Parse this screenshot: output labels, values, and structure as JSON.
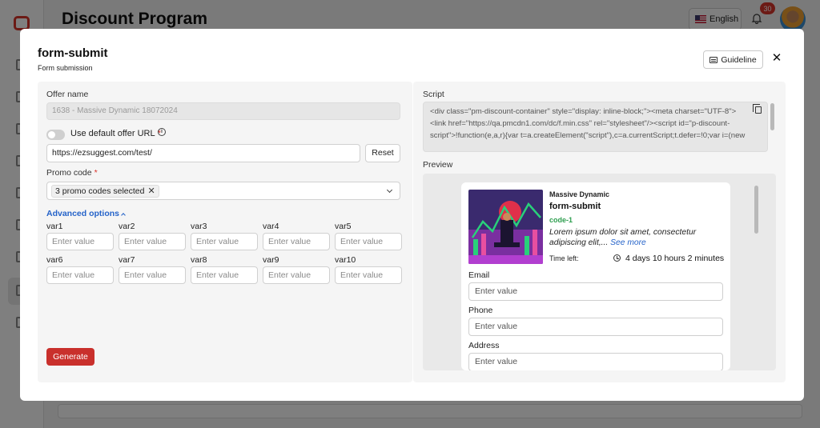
{
  "background": {
    "page_title": "Discount Program",
    "language": "English",
    "notification_count": "30"
  },
  "modal": {
    "title": "form-submit",
    "subtitle": "Form submission",
    "guideline_label": "Guideline",
    "close_label": "✕"
  },
  "form": {
    "offer_name_label": "Offer name",
    "offer_name_value": "1638 - Massive Dynamic 18072024",
    "default_url_toggle_label": "Use default offer URL",
    "default_url_toggle_on": false,
    "url_value": "https://ezsuggest.com/test/",
    "reset_label": "Reset",
    "promo_code_label": "Promo code",
    "promo_code_selected": "3 promo codes selected",
    "advanced_options_label": "Advanced options",
    "vars": [
      {
        "label": "var1",
        "placeholder": "Enter value"
      },
      {
        "label": "var2",
        "placeholder": "Enter value"
      },
      {
        "label": "var3",
        "placeholder": "Enter value"
      },
      {
        "label": "var4",
        "placeholder": "Enter value"
      },
      {
        "label": "var5",
        "placeholder": "Enter value"
      },
      {
        "label": "var6",
        "placeholder": "Enter value"
      },
      {
        "label": "var7",
        "placeholder": "Enter value"
      },
      {
        "label": "var8",
        "placeholder": "Enter value"
      },
      {
        "label": "var9",
        "placeholder": "Enter value"
      },
      {
        "label": "var10",
        "placeholder": "Enter value"
      }
    ],
    "generate_label": "Generate"
  },
  "script": {
    "label": "Script",
    "code": "<div class=\"pm-discount-container\" style=\"display: inline-block;\"><meta charset=\"UTF-8\"><link href=\"https://qa.pmcdn1.com/dc/f.min.css\" rel=\"stylesheet\"/><script id=\"p-discount-script\">!function(e,a,r){var t=a.createElement(\"script\"),c=a.currentScript;t.defer=!0;var i=(new"
  },
  "preview": {
    "label": "Preview",
    "brand": "Massive Dynamic",
    "title": "form-submit",
    "code": "code-1",
    "description": "Lorem ipsum dolor sit amet, consectetur adipiscing elit,...",
    "see_more": "See more",
    "time_left_label": "Time left:",
    "time_left_value": "4 days 10 hours 2 minutes",
    "fields": [
      {
        "label": "Email",
        "placeholder": "Enter value"
      },
      {
        "label": "Phone",
        "placeholder": "Enter value"
      },
      {
        "label": "Address",
        "placeholder": "Enter value"
      }
    ]
  },
  "colors": {
    "accent_blue": "#2563c9",
    "danger_red": "#c9302c",
    "code_green": "#2e9e4f"
  }
}
